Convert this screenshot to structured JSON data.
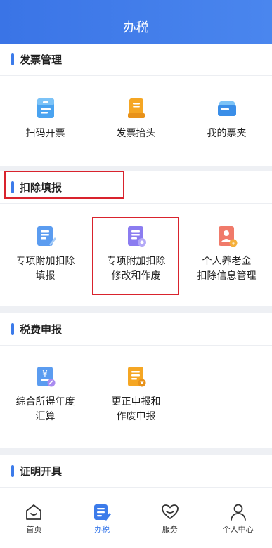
{
  "header": {
    "title": "办税"
  },
  "sections": [
    {
      "title": "发票管理",
      "items": [
        {
          "label": "扫码开票",
          "icon": "scan-invoice-icon"
        },
        {
          "label": "发票抬头",
          "icon": "invoice-title-icon"
        },
        {
          "label": "我的票夹",
          "icon": "ticket-folder-icon"
        }
      ]
    },
    {
      "title": "扣除填报",
      "items": [
        {
          "label": "专项附加扣除填报",
          "icon": "deduction-fill-icon"
        },
        {
          "label": "专项附加扣除修改和作废",
          "icon": "deduction-modify-icon"
        },
        {
          "label": "个人养老金扣除信息管理",
          "icon": "pension-icon"
        }
      ]
    },
    {
      "title": "税费申报",
      "items": [
        {
          "label": "综合所得年度汇算",
          "icon": "annual-settlement-icon"
        },
        {
          "label": "更正申报和作废申报",
          "icon": "correction-declare-icon"
        }
      ]
    },
    {
      "title": "证明开具",
      "items": []
    }
  ],
  "labels": {
    "s1": [
      "扫码开票",
      "发票抬头",
      "我的票夹"
    ],
    "s2": [
      [
        "专项附加扣除",
        "填报"
      ],
      [
        "专项附加扣除",
        "修改和作废"
      ],
      [
        "个人养老金",
        "扣除信息管理"
      ]
    ],
    "s3": [
      [
        "综合所得年度",
        "汇算"
      ],
      [
        "更正申报和",
        "作废申报"
      ]
    ]
  },
  "tabbar": {
    "active": "办税",
    "tabs": [
      {
        "label": "首页",
        "icon": "home-icon"
      },
      {
        "label": "办税",
        "icon": "tax-icon"
      },
      {
        "label": "服务",
        "icon": "service-icon"
      },
      {
        "label": "个人中心",
        "icon": "profile-icon"
      }
    ]
  },
  "colors": {
    "accent": "#3c7bea",
    "highlight": "#d9232d"
  }
}
